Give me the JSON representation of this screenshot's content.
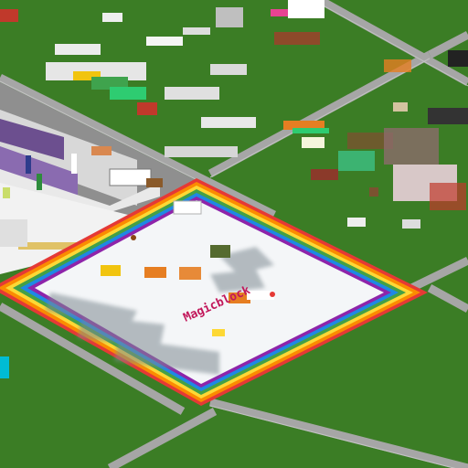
{
  "scene": {
    "type": "isometric voxel world",
    "sign_text": "Magicblock",
    "colors": {
      "grass": "#3b7d25",
      "grass_dark": "#2f6a1d",
      "road": "#9e9e9e",
      "road_line": "#bdbdbd",
      "plaza_floor": "#f4f6f8",
      "rainbow": [
        "#e53935",
        "#fb8c00",
        "#fdd835",
        "#43a047",
        "#1e88e5",
        "#8e24aa"
      ]
    }
  }
}
